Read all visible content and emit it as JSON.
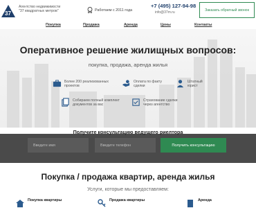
{
  "header": {
    "agency_line1": "Агентство недвижимости",
    "agency_line2": "\"37 квадратных метров\"",
    "since": "Работаем с 2011 года",
    "phone": "+7 (495) 127-94-98",
    "email": "info@37m.ru",
    "callback": "Заказать обратный звонок"
  },
  "nav": [
    "Покупка",
    "Продажа",
    "Аренда",
    "Цены",
    "Контакты"
  ],
  "hero": {
    "title": "Оперативное решение жилищных вопросов:",
    "subtitle": "покупка, продажа, аренда жилья",
    "features": [
      {
        "icon": "briefcase-icon",
        "text1": "Более 200 реализованных",
        "text2": "проектов"
      },
      {
        "icon": "payment-icon",
        "text1": "Оплата по факту",
        "text2": "сделки"
      },
      {
        "icon": "lawyer-icon",
        "text1": "Штатный",
        "text2": "юрист"
      },
      {
        "icon": "documents-icon",
        "text1": "Собираем полный комплект",
        "text2": "документов за вас"
      },
      {
        "icon": "insurance-icon",
        "text1": "Страхование сделки",
        "text2": "через агентство"
      }
    ]
  },
  "consult": {
    "title": "Получите консультацию ведущего риелтора",
    "name_placeholder": "Введите имя",
    "phone_placeholder": "Введите телефон",
    "submit": "Получить консультацию"
  },
  "services": {
    "title": "Покупка / продажа квартир, аренда жилья",
    "subtitle": "Услуги, которые мы предоставляем:",
    "items": [
      "Покупка квартиры",
      "Продажа квартиры",
      "Аренда"
    ]
  },
  "colors": {
    "brand_green": "#2f8a52",
    "dark_band": "#4a4a4a",
    "navy": "#1f3f6b"
  }
}
